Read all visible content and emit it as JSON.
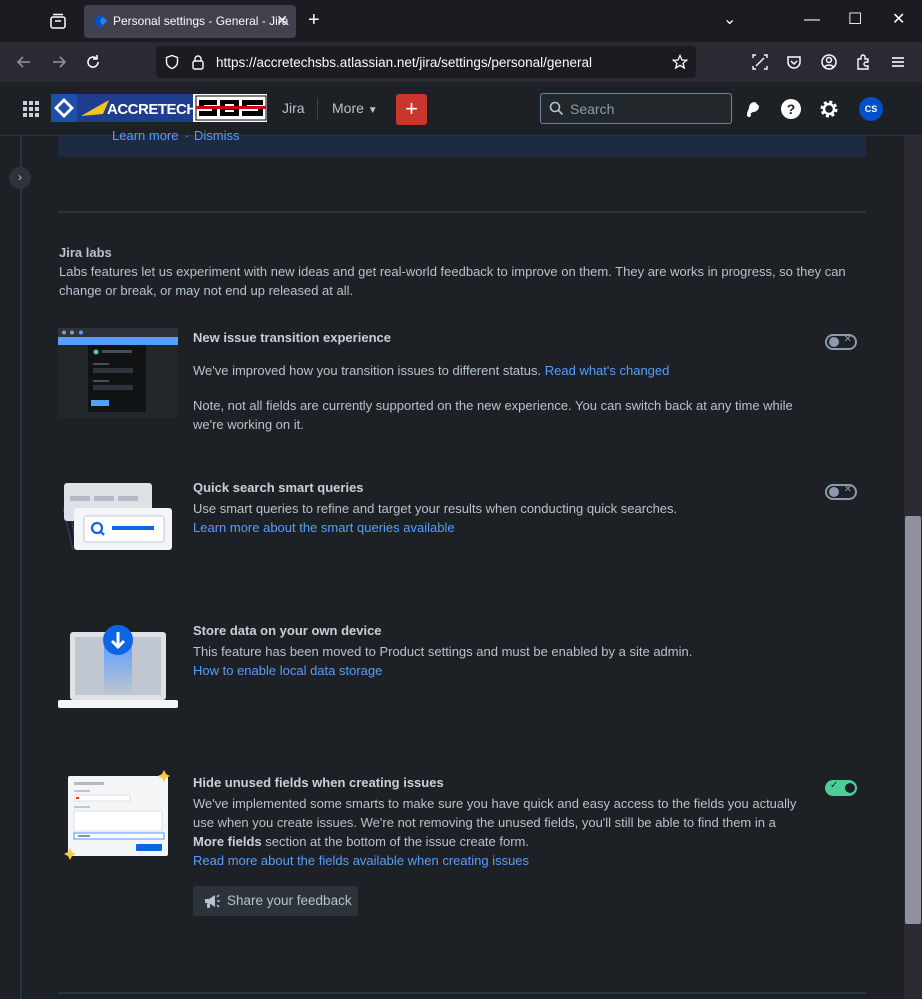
{
  "browser": {
    "tab_title": "Personal settings - General - Jira",
    "url": "https://accretechsbs.atlassian.net/jira/settings/personal/general"
  },
  "nav": {
    "jira": "Jira",
    "more": "More",
    "search_placeholder": "Search",
    "avatar_initials": "CS"
  },
  "banner": {
    "learn_more": "Learn more",
    "separator": "·",
    "dismiss": "Dismiss"
  },
  "labs": {
    "title": "Jira labs",
    "description": "Labs features let us experiment with new ideas and get real-world feedback to improve on them. They are works in progress, so they can change or break, or may not end up released at all."
  },
  "features": [
    {
      "title": "New issue transition experience",
      "text1": "We've improved how you transition issues to different status.",
      "link1": "Read what's changed",
      "text2": "Note, not all fields are currently supported on the new experience. You can switch back at any time while we're working on it.",
      "enabled": false
    },
    {
      "title": "Quick search smart queries",
      "text1": "Use smart queries to refine and target your results when conducting quick searches.",
      "link1": "Learn more about the smart queries available",
      "enabled": false
    },
    {
      "title": "Store data on your own device",
      "text1": "This feature has been moved to Product settings and must be enabled by a site admin.",
      "link1": "How to enable local data storage"
    },
    {
      "title": "Hide unused fields when creating issues",
      "text1": "We've implemented some smarts to make sure you have quick and easy access to the fields you actually use when you create issues. We're not removing the unused fields, you'll still be able to find them in a",
      "bold": "More fields",
      "text2": "section at the bottom of the issue create form.",
      "link1": "Read more about the fields available when creating issues",
      "enabled": true,
      "feedback_label": "Share your feedback"
    }
  ],
  "colors": {
    "background": "#1d2125",
    "link": "#579dff",
    "toggle_on": "#4bce97",
    "create_button": "#c9372c"
  }
}
